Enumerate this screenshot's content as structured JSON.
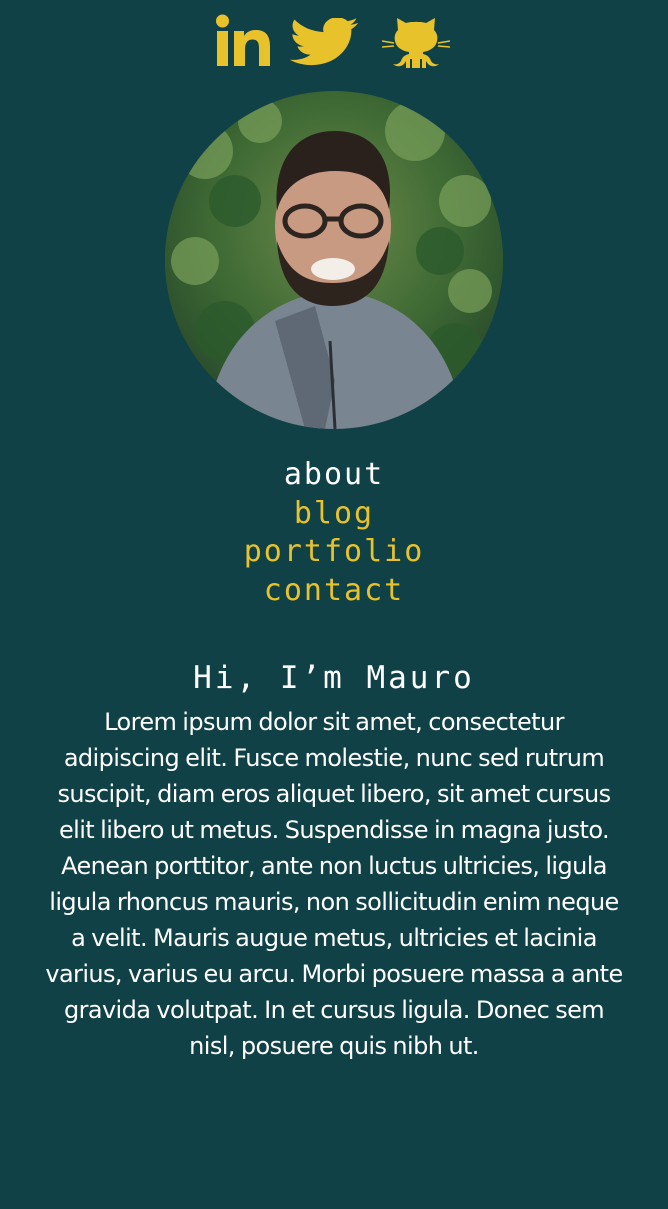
{
  "social": [
    {
      "name": "linkedin-icon",
      "label": "LinkedIn"
    },
    {
      "name": "twitter-icon",
      "label": "Twitter"
    },
    {
      "name": "github-icon",
      "label": "GitHub"
    }
  ],
  "colors": {
    "background": "#0f4147",
    "accent": "#e8c22a",
    "text": "#ffffff"
  },
  "nav": {
    "items": [
      {
        "label": "about",
        "active": true
      },
      {
        "label": "blog",
        "active": false
      },
      {
        "label": "portfolio",
        "active": false
      },
      {
        "label": "contact",
        "active": false
      }
    ]
  },
  "intro": {
    "heading": "Hi, I’m Mauro",
    "body": "Lorem ipsum dolor sit amet, consectetur adipiscing elit. Fusce molestie, nunc sed rutrum suscipit, diam eros aliquet libero, sit amet cursus elit libero ut metus. Suspendisse in magna justo. Aenean porttitor, ante non luctus ultricies, ligula ligula rhoncus mauris, non sollicitudin enim neque a velit. Mauris augue metus, ultricies et lacinia varius, varius eu arcu. Morbi posuere massa a ante gravida volutpat. In et cursus ligula. Donec sem nisl, posuere quis nibh ut."
  }
}
